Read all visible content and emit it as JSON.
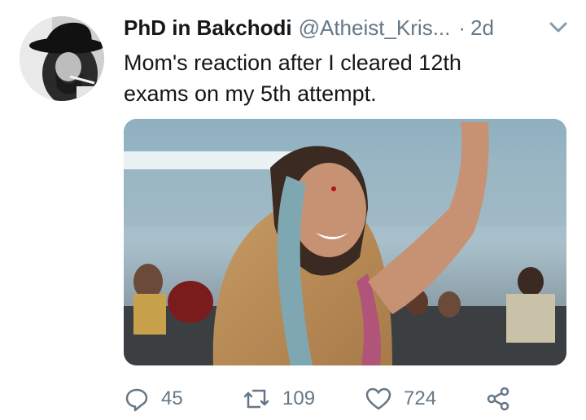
{
  "tweet": {
    "display_name": "PhD in Bakchodi",
    "handle": "@Atheist_Kris...",
    "separator": "·",
    "timestamp": "2d",
    "text_lines": [
      "Mom's reaction after I cleared 12th",
      "exams on my 5th attempt."
    ]
  },
  "actions": {
    "reply_count": "45",
    "retweet_count": "109",
    "like_count": "724"
  },
  "icons": {
    "reply": "reply-icon",
    "retweet": "retweet-icon",
    "like": "heart-icon",
    "share": "share-icon",
    "caret": "chevron-down-icon"
  },
  "colors": {
    "text": "#14171a",
    "muted": "#657786"
  }
}
